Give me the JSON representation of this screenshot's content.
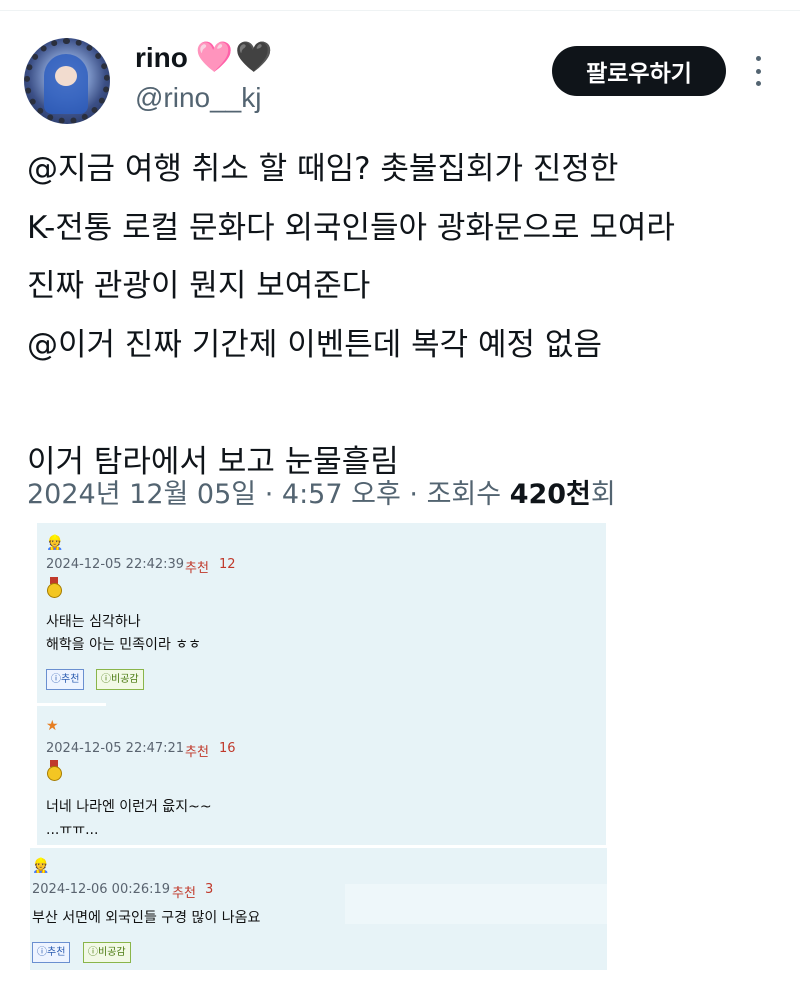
{
  "tweet": {
    "author": {
      "name": "rino",
      "hearts": [
        "🩷",
        "🖤"
      ],
      "handle": "@rino__kj",
      "avatar_icon": "avatar-icon"
    },
    "follow_label": "팔로우하기",
    "lines": [
      "@지금 여행 취소 할 때임? 촛불집회가 진정한",
      "K-전통 로컬 문화다 외국인들아 광화문으로 모여라",
      "진짜 관광이 뭔지 보여준다",
      "@이거 진짜 기간제 이벤튼데 복각 예정 없음",
      "",
      "이거 탐라에서 보고 눈물흘림"
    ],
    "meta": {
      "date": "2024년 12월 05일",
      "time": "4:57 오후",
      "views_label": "조회수",
      "views_value": "420천",
      "views_suffix": "회"
    }
  },
  "comments": [
    {
      "icon": "👷",
      "date": "2024-12-05 22:42:39",
      "rec_label": "추천",
      "rec_count": "12",
      "lines": [
        "사태는 심각하나",
        "해학을 아는 민족이라 ㅎㅎ"
      ],
      "rec_button": "추천",
      "nrec_button": "비공감"
    },
    {
      "icon": "★",
      "date": "2024-12-05 22:47:21",
      "rec_label": "추천",
      "rec_count": "16",
      "lines": [
        "너네 나라엔 이런거 읎지~~",
        "...ㅠㅠ..."
      ]
    },
    {
      "icon": "👷",
      "date": "2024-12-06 00:26:19",
      "rec_label": "추천",
      "rec_count": "3",
      "lines": [
        "부산 서면에 외국인들 구경 많이 나옴요"
      ],
      "rec_button": "추천",
      "nrec_button": "비공감"
    }
  ],
  "colors": {
    "panel_bg": "#e7f3f7",
    "follow_bg": "#0f1419",
    "rec_red": "#c0392b",
    "muted": "#536471"
  }
}
